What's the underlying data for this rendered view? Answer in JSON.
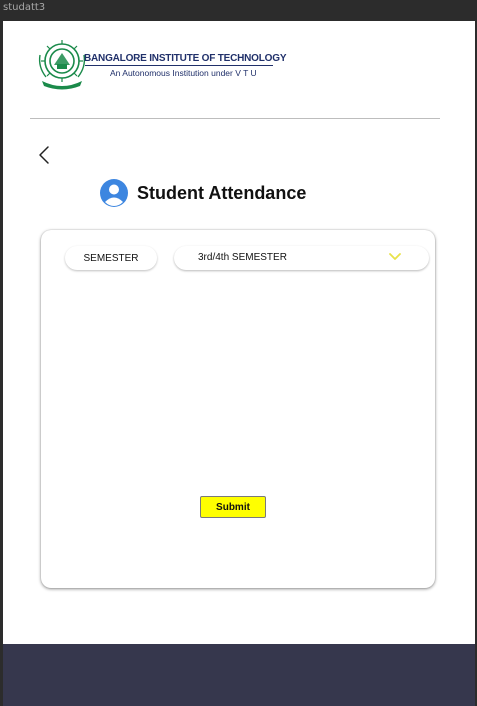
{
  "frame": {
    "label": "studatt3"
  },
  "header": {
    "institution_name": "BANGALORE INSTITUTE OF TECHNOLOGY",
    "tagline": "An Autonomous Institution under V T U",
    "logo_icon": "institute-crest",
    "brand_color": "#20306a",
    "logo_color": "#1a8a4a"
  },
  "nav": {
    "back_icon": "chevron-left-icon"
  },
  "page": {
    "title": "Student Attendance",
    "title_icon": "user-avatar-icon",
    "icon_color": "#3d86e0"
  },
  "form": {
    "semester_label": "SEMESTER",
    "semester_selected": "3rd/4th SEMESTER",
    "dropdown_icon": "chevron-down-icon",
    "dropdown_icon_color": "#e8e24a",
    "submit_label": "Submit",
    "submit_color": "#ffff00"
  },
  "footer": {
    "bar_color": "#36374d"
  }
}
